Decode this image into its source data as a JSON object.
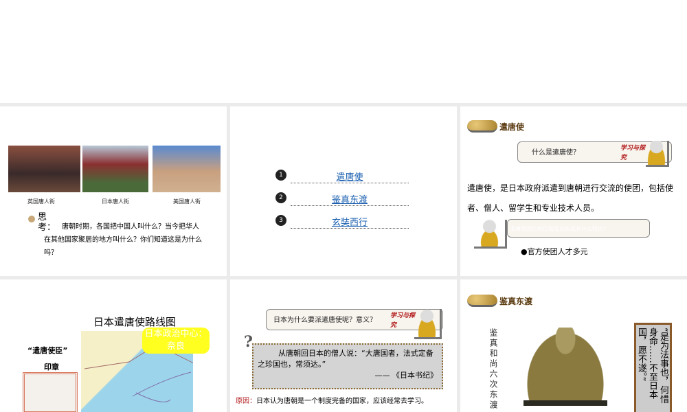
{
  "slide1": {
    "captions": [
      "英国唐人街",
      "日本唐人街",
      "美国唐人街"
    ],
    "think_label": "思考：",
    "question": "唐朝时期，各国把中国人叫什么？当今把华人在其他国家聚居的地方叫什么？你们知道这是为什么吗？"
  },
  "slide2": {
    "items": [
      {
        "num": "1",
        "label": "遣唐使"
      },
      {
        "num": "2",
        "label": "鉴真东渡"
      },
      {
        "num": "3",
        "label": "玄奘西行"
      }
    ]
  },
  "slide3": {
    "heading": "遣唐使",
    "question": "什么是遣唐使？",
    "study_badge": "学习与探究",
    "definition": "遣唐使，是日本政府派遣到唐朝进行交流的使团，包括使者、僧人、留学生和专业技术人员。",
    "question2": "遣唐使团的地位和成员构成有什么特点？",
    "bullet": "●官方使团人才多元"
  },
  "slide4": {
    "title": "日本遣唐使路线图",
    "seal_label": "“遣唐使臣”",
    "seal_label2": "印章",
    "callout": "日本政治中心：奈良"
  },
  "slide5": {
    "question": "日本为什么要派遣唐使呢？意义？",
    "study_badge": "学习与探究",
    "quote": "从唐朝回日本的僧人说：“大唐国者，法式定备之珍国也，常须达。”",
    "source": "——  《日本书纪》",
    "reason_label": "原因：",
    "reason": "日本认为唐朝是一个制度完备的国家，应该经常去学习。"
  },
  "slide6": {
    "heading": "鉴真东渡",
    "vertical_text": "鉴真和尚六次东渡",
    "quote": "“是为法事也，何惜身命……不至日本国，愿不遂。”"
  }
}
